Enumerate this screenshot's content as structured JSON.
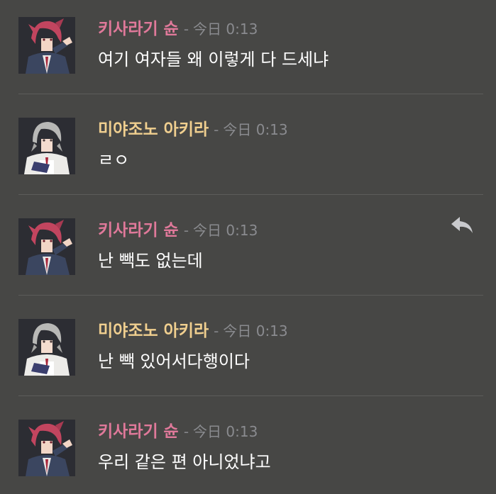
{
  "colors": {
    "background": "#474745",
    "divider": "#5c5c5a",
    "shun_name": "#e0799a",
    "akira_name": "#f0cf8f",
    "timestamp": "#8a8b8f",
    "message_text": "#ffffff"
  },
  "separator": "-",
  "messages": [
    {
      "author": "키사라기 슌",
      "author_color": "#e0799a",
      "avatar": "shun-avatar",
      "time": "今日 0:13",
      "text": "여기 여자들 왜 이렇게 다 드세냐"
    },
    {
      "author": "미야조노 아키라",
      "author_color": "#f0cf8f",
      "avatar": "akira-avatar",
      "time": "今日 0:13",
      "text": "ㄹㅇ"
    },
    {
      "author": "키사라기 슌",
      "author_color": "#e0799a",
      "avatar": "shun-avatar",
      "time": "今日 0:13",
      "text": "난 빽도 없는데",
      "hover_icon": "reply-icon"
    },
    {
      "author": "미야조노 아키라",
      "author_color": "#f0cf8f",
      "avatar": "akira-avatar",
      "time": "今日 0:13",
      "text": "난 빽 있어서다행이다"
    },
    {
      "author": "키사라기 슌",
      "author_color": "#e0799a",
      "avatar": "shun-avatar",
      "time": "今日 0:13",
      "text": "우리 같은 편 아니었냐고"
    }
  ]
}
